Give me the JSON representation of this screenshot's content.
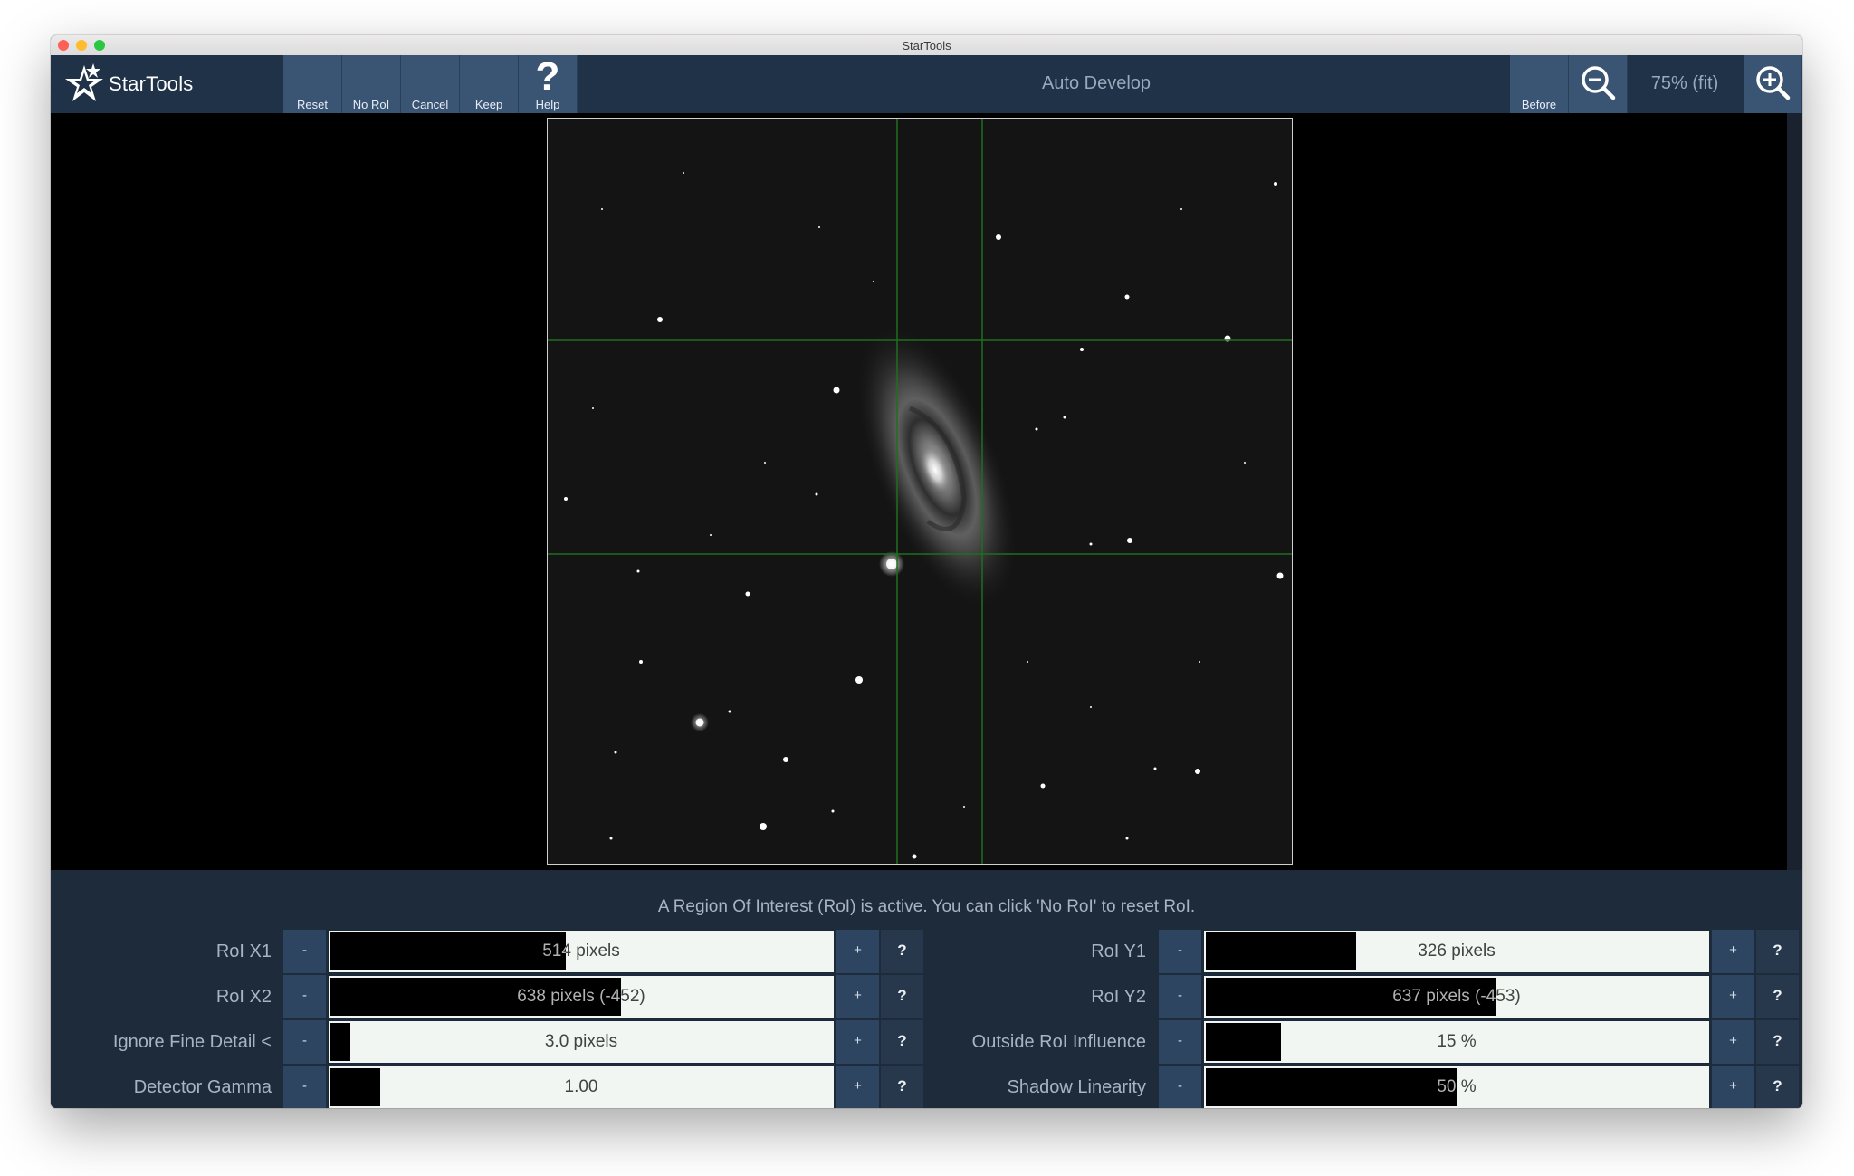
{
  "window": {
    "title": "StarTools"
  },
  "toolbar": {
    "logo": "StarTools",
    "buttons": [
      "Reset",
      "No RoI",
      "Cancel",
      "Keep",
      "Help"
    ],
    "help_glyph": "?",
    "module_title": "Auto Develop",
    "before_label": "Before",
    "zoom_level": "75% (fit)"
  },
  "status": {
    "message": "A Region Of Interest (RoI) is active. You can click 'No RoI' to reset RoI."
  },
  "params": {
    "left": [
      {
        "label": "RoI X1",
        "value": "514 pixels",
        "level": 0.47
      },
      {
        "label": "RoI X2",
        "value": "638 pixels (-452)",
        "level": 0.58
      },
      {
        "label": "Ignore Fine Detail <",
        "value": "3.0 pixels",
        "level": 0.04
      },
      {
        "label": "Detector Gamma",
        "value": "1.00",
        "level": 0.1
      }
    ],
    "right": [
      {
        "label": "RoI Y1",
        "value": "326 pixels",
        "level": 0.3
      },
      {
        "label": "RoI Y2",
        "value": "637 pixels (-453)",
        "level": 0.58
      },
      {
        "label": "Outside RoI Influence",
        "value": "15 %",
        "level": 0.15
      },
      {
        "label": "Shadow Linearity",
        "value": "50 %",
        "level": 0.5
      }
    ],
    "minus_label": "-",
    "plus_label": "+",
    "help_label": "?"
  },
  "colors": {
    "toolbar_bg": "#1f3247",
    "button_bg": "#3a5474",
    "panel_bg": "#1d2b3b",
    "roi_line": "#1f6f1f",
    "slider_track": "#f2f6f3"
  }
}
